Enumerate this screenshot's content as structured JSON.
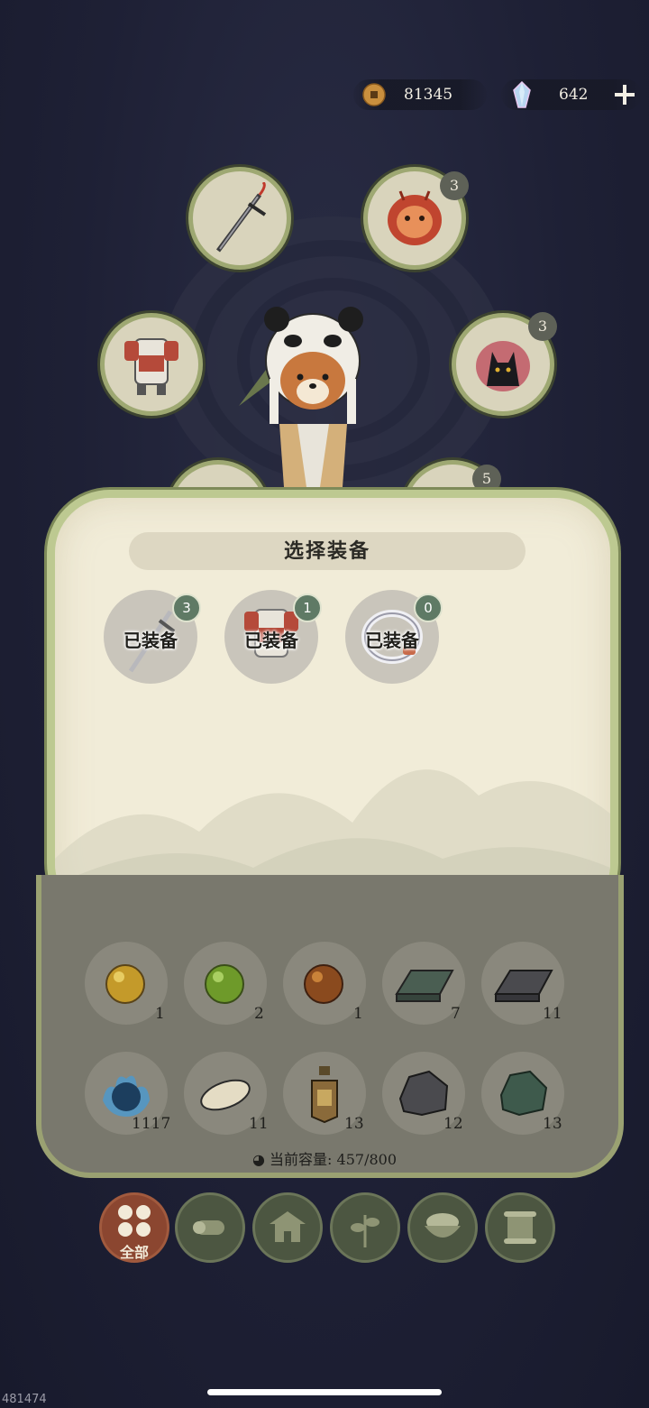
{
  "currency": {
    "coins": "81345",
    "gems": "642",
    "gold_color": "#c98f3e",
    "gem_color": "#b8d6f0"
  },
  "equipment_slots": [
    {
      "icon": "sword-icon",
      "badge": ""
    },
    {
      "icon": "demon-mask-icon",
      "badge": "3"
    },
    {
      "icon": "armor-icon",
      "badge": ""
    },
    {
      "icon": "anubis-mask-icon",
      "badge": "3"
    },
    {
      "icon": "partial-slot-icon",
      "badge": "5"
    }
  ],
  "modal": {
    "title": "选择装备",
    "items": [
      {
        "icon": "sword-icon",
        "label": "已装备",
        "count": "3"
      },
      {
        "icon": "armor-icon",
        "label": "已装备",
        "count": "1"
      },
      {
        "icon": "ring-icon",
        "label": "已装备",
        "count": "0"
      }
    ]
  },
  "inventory": {
    "items": [
      {
        "icon": "yellow-orb-icon",
        "count": "1"
      },
      {
        "icon": "green-orb-icon",
        "count": "2"
      },
      {
        "icon": "brown-orb-icon",
        "count": "1"
      },
      {
        "icon": "green-ingot-icon",
        "count": "7"
      },
      {
        "icon": "iron-ingot-icon",
        "count": "11"
      },
      {
        "icon": "blue-flame-orb-icon",
        "count": "1117"
      },
      {
        "icon": "potato-icon",
        "count": "11"
      },
      {
        "icon": "bottle-icon",
        "count": "13"
      },
      {
        "icon": "stone-icon",
        "count": "12"
      },
      {
        "icon": "green-ore-icon",
        "count": "13"
      }
    ],
    "capacity": "当前容量: 457/800"
  },
  "tabs": [
    {
      "icon": "grid-icon",
      "label": "全部",
      "active": true
    },
    {
      "icon": "wood-icon",
      "label": ""
    },
    {
      "icon": "house-icon",
      "label": ""
    },
    {
      "icon": "herb-icon",
      "label": ""
    },
    {
      "icon": "bowl-icon",
      "label": ""
    },
    {
      "icon": "scroll-icon",
      "label": ""
    }
  ],
  "footer": {
    "id": "481474"
  }
}
